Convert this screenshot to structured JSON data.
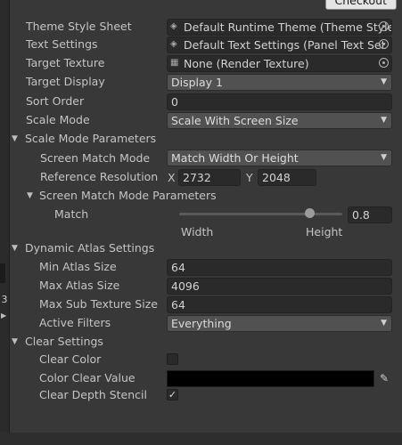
{
  "header": {
    "checkout_label": "Checkout"
  },
  "left_strip": {
    "glyph": "3",
    "arrow": "▶"
  },
  "fields": {
    "theme_style_sheet": {
      "label": "Theme Style Sheet",
      "value": "Default Runtime Theme (Theme Style",
      "icon": "theme-icon"
    },
    "text_settings": {
      "label": "Text Settings",
      "value": "Default Text Settings (Panel Text Set",
      "icon": "text-settings-icon"
    },
    "target_texture": {
      "label": "Target Texture",
      "value": "None (Render Texture)",
      "icon": "render-texture-icon"
    },
    "target_display": {
      "label": "Target Display",
      "value": "Display 1"
    },
    "sort_order": {
      "label": "Sort Order",
      "value": "0"
    },
    "scale_mode": {
      "label": "Scale Mode",
      "value": "Scale With Screen Size"
    }
  },
  "scale_mode_parameters": {
    "header": "Scale Mode Parameters",
    "screen_match_mode": {
      "label": "Screen Match Mode",
      "value": "Match Width Or Height"
    },
    "reference_resolution": {
      "label": "Reference Resolution",
      "x_label": "X",
      "x_value": "2732",
      "y_label": "Y",
      "y_value": "2048"
    },
    "screen_match_mode_parameters": {
      "header": "Screen Match Mode Parameters",
      "match": {
        "label": "Match",
        "value": "0.8",
        "fraction": 0.8,
        "left_label": "Width",
        "right_label": "Height"
      }
    }
  },
  "dynamic_atlas_settings": {
    "header": "Dynamic Atlas Settings",
    "min_atlas_size": {
      "label": "Min Atlas Size",
      "value": "64"
    },
    "max_atlas_size": {
      "label": "Max Atlas Size",
      "value": "4096"
    },
    "max_sub_texture_size": {
      "label": "Max Sub Texture Size",
      "value": "64"
    },
    "active_filters": {
      "label": "Active Filters",
      "value": "Everything"
    }
  },
  "clear_settings": {
    "header": "Clear Settings",
    "clear_color": {
      "label": "Clear Color",
      "checked": false
    },
    "color_clear_value": {
      "label": "Color Clear Value",
      "color": "#000000"
    },
    "clear_depth_stencil": {
      "label": "Clear Depth Stencil",
      "checked": true,
      "check_glyph": "✓"
    }
  },
  "glyphs": {
    "fold_open": "▼",
    "caret": "▼",
    "eyedropper": "✎",
    "object": "◈",
    "texture": "▦"
  }
}
